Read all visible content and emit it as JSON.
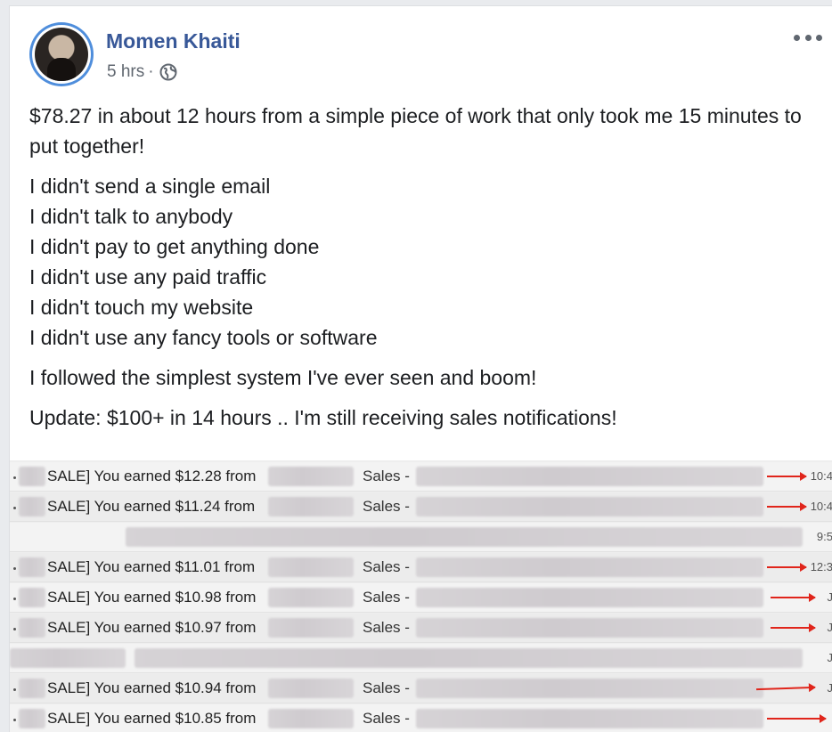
{
  "post": {
    "author": "Momen Khaiti",
    "time": "5 hrs",
    "separator": "·",
    "privacy_icon": "globe-icon",
    "lines": [
      "$78.27 in about 12 hours from a simple piece of work that only took me 15 minutes to put together!",
      "I didn't send a single email",
      "I didn't talk to anybody",
      "I didn't pay to get anything done",
      "I didn't use any paid traffic",
      "I didn't touch my website",
      "I didn't use any fancy tools or software",
      "I followed the simplest system I've ever seen and boom!",
      "Update: $100+ in 14 hours .. I'm still receiving sales notifications!"
    ]
  },
  "emails": [
    {
      "subject": "SALE] You earned $12.28 from",
      "folder": "Sales -",
      "time": "10:4"
    },
    {
      "subject": "SALE] You earned $11.24 from",
      "folder": "Sales -",
      "time": "10:4"
    },
    {
      "subject": "",
      "folder": "",
      "time": "9:5"
    },
    {
      "subject": "SALE] You earned $11.01 from",
      "folder": "Sales -",
      "time": "12:3"
    },
    {
      "subject": "SALE] You earned $10.98 from",
      "folder": "Sales -",
      "time": "J"
    },
    {
      "subject": "SALE] You earned $10.97 from",
      "folder": "Sales -",
      "time": "J"
    },
    {
      "subject": "",
      "folder": "",
      "time": "J"
    },
    {
      "subject": "SALE] You earned $10.94 from",
      "folder": "Sales -",
      "time": "J"
    },
    {
      "subject": "SALE] You earned $10.85 from",
      "folder": "Sales -",
      "time": ""
    }
  ],
  "colors": {
    "author": "#385898",
    "arrow": "#e0251b",
    "avatar_ring": "#4f8edc"
  }
}
